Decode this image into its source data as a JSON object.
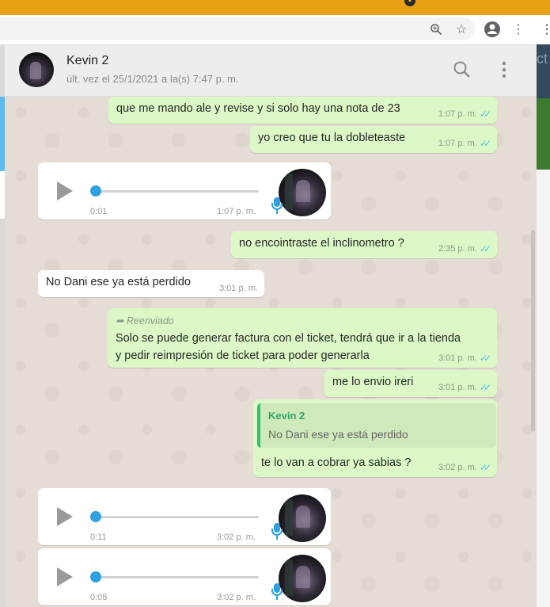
{
  "header": {
    "name": "Kevin 2",
    "status": "últ. vez el 25/1/2021 a la(s) 7:47 p. m."
  },
  "right_strip_text": "ct",
  "messages": [
    {
      "type": "text",
      "dir": "out",
      "text": "que me mando ale y revise y si solo hay una nota de 23",
      "time": "1:07 p. m."
    },
    {
      "type": "text",
      "dir": "out",
      "text": "yo creo que tu la dobleteaste",
      "time": "1:07 p. m."
    },
    {
      "type": "voice",
      "dir": "in",
      "duration": "0:01",
      "time": "1:07 p. m."
    },
    {
      "type": "text",
      "dir": "out",
      "text": "no encointraste el inclinometro ?",
      "time": "2:35 p. m."
    },
    {
      "type": "text",
      "dir": "in",
      "text": "No Dani ese ya está perdido",
      "time": "3:01 p. m."
    },
    {
      "type": "forwarded",
      "dir": "out",
      "forwarded_label": "Reenviado",
      "line1": "Solo se puede generar factura con el ticket, tendrá que ir a la tienda",
      "line2": "y pedir reimpresión de ticket para poder generarla",
      "time": "3:01 p. m."
    },
    {
      "type": "text",
      "dir": "out",
      "text": "me lo envio ireri",
      "time": "3:01 p. m."
    },
    {
      "type": "reply",
      "dir": "out",
      "quote_name": "Kevin 2",
      "quote_text": "No Dani ese ya está perdido",
      "text": "te lo van a cobrar ya sabias ?",
      "time": "3:02 p. m."
    },
    {
      "type": "voice",
      "dir": "in",
      "duration": "0:11",
      "time": "3:02 p. m."
    },
    {
      "type": "voice",
      "dir": "in",
      "duration": "0:08",
      "time": "3:02 p. m."
    }
  ]
}
